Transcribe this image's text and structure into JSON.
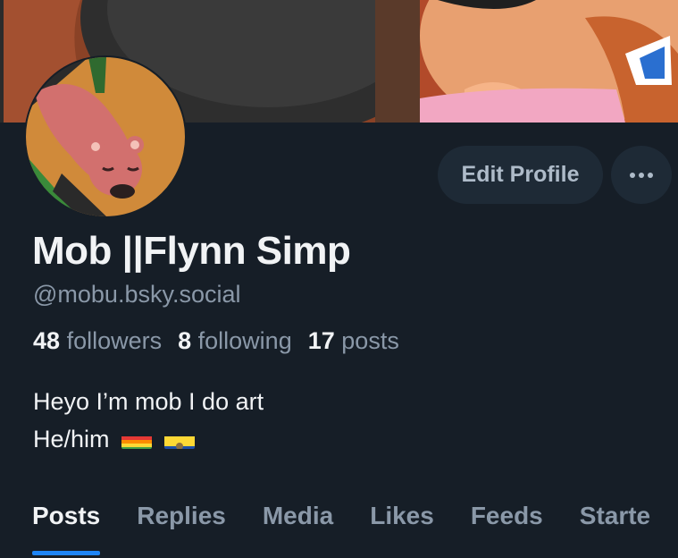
{
  "profile": {
    "display_name": "Mob ||Flynn Simp",
    "handle": "@mobu.bsky.social",
    "followers_count": "48",
    "followers_label": "followers",
    "following_count": "8",
    "following_label": "following",
    "posts_count": "17",
    "posts_label": "posts",
    "bio_line1": "Heyo I’m mob I do art",
    "bio_line2": "He/him"
  },
  "actions": {
    "edit_label": "Edit Profile",
    "more_label": "···"
  },
  "tabs": [
    {
      "label": "Posts",
      "active": true
    },
    {
      "label": "Replies",
      "active": false
    },
    {
      "label": "Media",
      "active": false
    },
    {
      "label": "Likes",
      "active": false
    },
    {
      "label": "Feeds",
      "active": false
    },
    {
      "label": "Starte",
      "active": false
    }
  ],
  "colors": {
    "background": "#161e27",
    "accent": "#1e85f6",
    "muted_text": "#8a98a8",
    "button_bg": "#1e2a36"
  }
}
